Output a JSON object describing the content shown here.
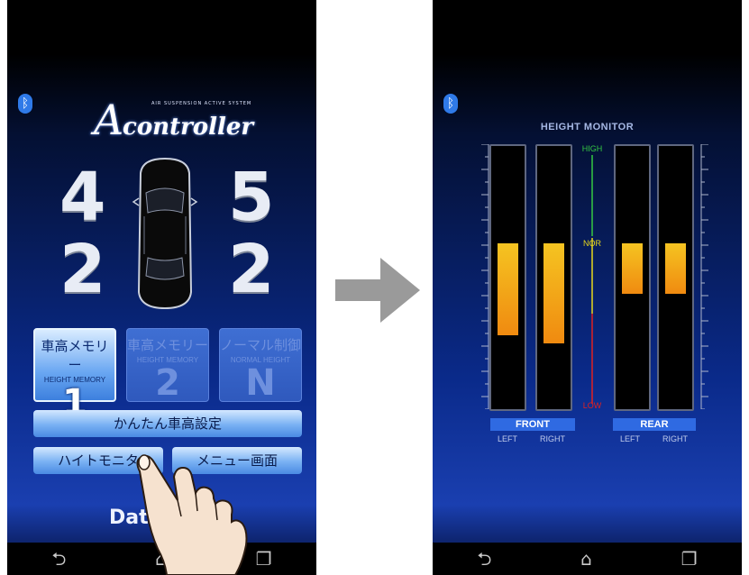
{
  "left_screen": {
    "logo": {
      "small_text": "AIR SUSPENSION ACTIVE SYSTEM",
      "big_letter": "A",
      "word": "controller"
    },
    "height_values": {
      "front_left": "4",
      "front_right": "5",
      "rear_left": "2",
      "rear_right": "2"
    },
    "memory_buttons": [
      {
        "jp": "車高メモリー",
        "en": "HEIGHT MEMORY",
        "num": "1"
      },
      {
        "jp": "車高メモリー",
        "en": "HEIGHT MEMORY",
        "num": "2"
      },
      {
        "jp": "ノーマル制御",
        "en": "NORMAL HEIGHT",
        "num": "N"
      }
    ],
    "easy_setting_button": "かんたん車高設定",
    "height_monitor_button": "ハイトモニタ",
    "menu_button": "メニュー画面",
    "brand_text": "Dat"
  },
  "right_screen": {
    "title": "HEIGHT MONITOR",
    "labels": {
      "high": "HIGH",
      "nor": "NOR",
      "low": "LOW"
    },
    "groups": {
      "front": "FRONT",
      "rear": "REAR"
    },
    "sub_labels": {
      "left": "LEFT",
      "right": "RIGHT"
    },
    "bars": [
      {
        "name": "front-left",
        "top": 0.37,
        "bottom": 0.72
      },
      {
        "name": "front-right",
        "top": 0.37,
        "bottom": 0.75
      },
      {
        "name": "rear-left",
        "top": 0.37,
        "bottom": 0.56
      },
      {
        "name": "rear-right",
        "top": 0.37,
        "bottom": 0.56
      }
    ]
  },
  "nav_icons": [
    "back-icon",
    "home-icon",
    "recent-apps-icon"
  ],
  "colors": {
    "button_blue": "#79b1f3",
    "bar_fill_top": "#f5c421",
    "bar_fill_bottom": "#f08a10",
    "high_green": "#35c843",
    "nor_yellow": "#e8d81c",
    "low_red": "#e02020",
    "group_blue": "#2f6ae2"
  }
}
